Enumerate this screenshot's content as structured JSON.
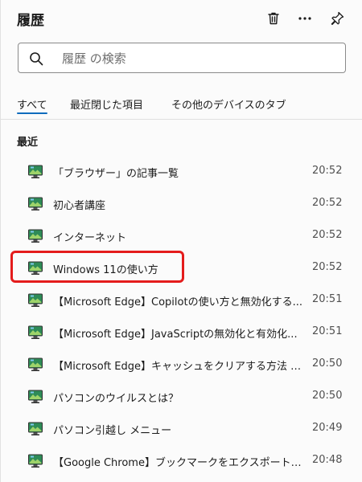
{
  "panel": {
    "title": "履歴"
  },
  "header": {
    "icons": [
      "trash-icon",
      "more-icon",
      "pin-icon"
    ]
  },
  "search": {
    "placeholder": "履歴 の検索",
    "value": ""
  },
  "tabs": [
    {
      "label": "すべて",
      "active": true
    },
    {
      "label": "最近閉じた項目",
      "active": false
    },
    {
      "label": "その他のデバイスのタブ",
      "active": false
    }
  ],
  "section": {
    "title": "最近"
  },
  "items": [
    {
      "title": "「ブラウザー」の記事一覧",
      "time": "20:52"
    },
    {
      "title": "初心者講座",
      "time": "20:52"
    },
    {
      "title": "インターネット",
      "time": "20:52"
    },
    {
      "title": "Windows 11の使い方",
      "time": "20:52",
      "highlighted": true
    },
    {
      "title": "【Microsoft Edge】Copilotの使い方と無効化する...",
      "time": "20:51"
    },
    {
      "title": "【Microsoft Edge】JavaScriptの無効化と有効化...",
      "time": "20:51"
    },
    {
      "title": "【Microsoft Edge】キャッシュをクリアする方法 | ショ...",
      "time": "20:50"
    },
    {
      "title": "パソコンのウイルスとは？",
      "time": "20:50"
    },
    {
      "title": "パソコン引越し メニュー",
      "time": "20:49"
    },
    {
      "title": "【Google Chrome】ブックマークをエクスポートやイン...",
      "time": "20:48"
    }
  ],
  "colors": {
    "accent": "#0f6cbd",
    "highlight": "#e41c1c"
  }
}
